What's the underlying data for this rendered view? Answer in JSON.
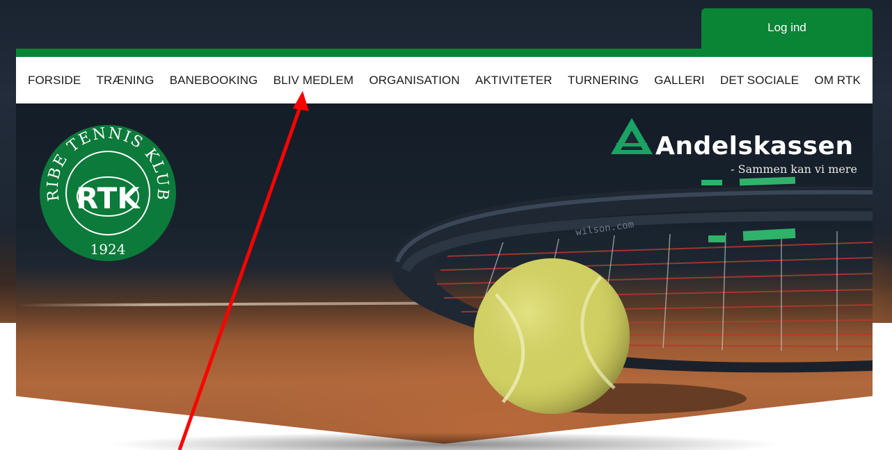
{
  "header": {
    "login_label": "Log ind"
  },
  "nav": {
    "items": [
      {
        "label": "FORSIDE"
      },
      {
        "label": "TRÆNING"
      },
      {
        "label": "BANEBOOKING"
      },
      {
        "label": "BLIV MEDLEM"
      },
      {
        "label": "ORGANISATION"
      },
      {
        "label": "AKTIVITETER"
      },
      {
        "label": "TURNERING"
      },
      {
        "label": "GALLERI"
      },
      {
        "label": "DET SOCIALE"
      },
      {
        "label": "OM RTK"
      }
    ]
  },
  "logo": {
    "ring_text": "RIBE TENNIS KLUB",
    "initials": "RTK",
    "year": "1924"
  },
  "sponsor": {
    "name": "Andelskassen",
    "tagline": "- Sammen kan vi mere"
  },
  "racket_brand": "wilson.com",
  "colors": {
    "brand_green": "#0a8536",
    "annotation_red": "#ff0000",
    "ball_yellow": "#d8d66a"
  },
  "icons": {
    "sponsor_logo": "triangle-a-logo-icon",
    "annotation": "red-arrow-icon"
  }
}
